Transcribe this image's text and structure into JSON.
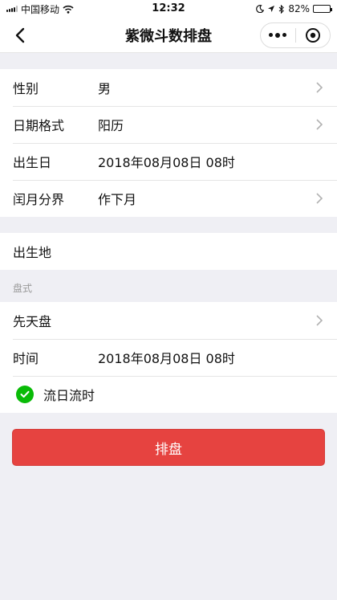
{
  "status_bar": {
    "carrier": "中国移动",
    "time": "12:32",
    "battery": "82%",
    "battery_level": 0.82
  },
  "nav": {
    "title": "紫微斗数排盘"
  },
  "form": {
    "basic": [
      {
        "label": "性别",
        "value": "男",
        "has_arrow": true
      },
      {
        "label": "日期格式",
        "value": "阳历",
        "has_arrow": true
      },
      {
        "label": "出生日",
        "value": "2018年08月08日 08时",
        "has_arrow": false
      },
      {
        "label": "闰月分界",
        "value": "作下月",
        "has_arrow": true
      }
    ],
    "birthplace": {
      "label": "出生地",
      "value": ""
    },
    "chart_section_caption": "盘式",
    "chart_type": {
      "label": "先天盘",
      "has_arrow": true
    },
    "time": {
      "label": "时间",
      "value": "2018年08月08日 08时"
    },
    "liuri": {
      "label": "流日流时",
      "checked": true
    }
  },
  "submit": {
    "label": "排盘"
  },
  "colors": {
    "accent": "#e64340",
    "check": "#09bb07",
    "background": "#efeff4"
  }
}
